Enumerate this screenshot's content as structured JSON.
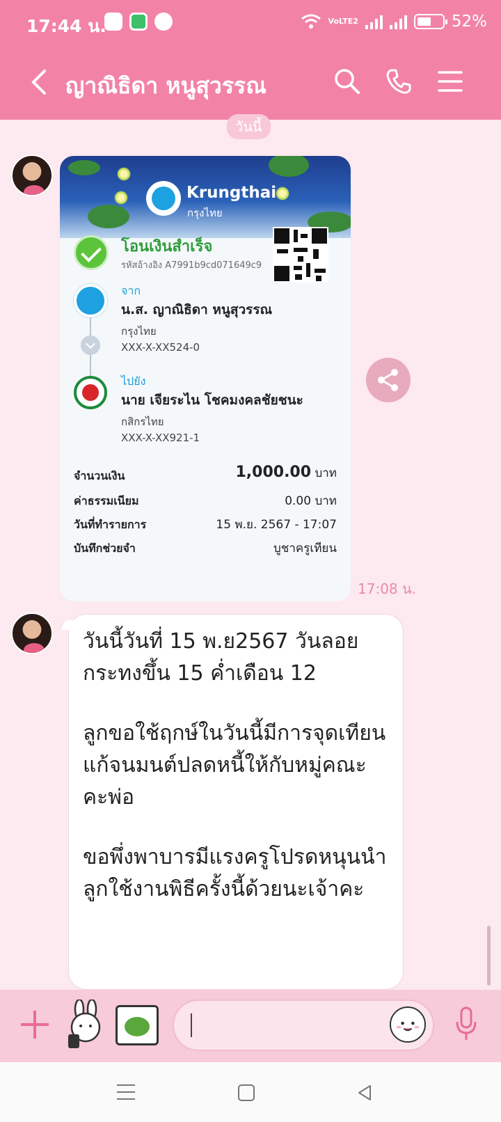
{
  "status_bar": {
    "time": "17:44 น.",
    "notification_icons": [
      "line-icon",
      "message-icon",
      "krungthai-icon"
    ],
    "network_label": "VoLTE2",
    "battery": "52%",
    "battery_level": 0.52
  },
  "header": {
    "title": "ญาณิธิดา หนูสุวรรณ",
    "icons": [
      "back-icon",
      "search-icon",
      "phone-icon",
      "menu-icon"
    ]
  },
  "chat": {
    "date_separator": "วันนี้",
    "slip": {
      "bank_name_en": "Krungthai",
      "bank_name_th": "กรุงไทย",
      "status": "โอนเงินสำเร็จ",
      "reference": "รหัสอ้างอิง A7991b9cd071649c9",
      "from": {
        "label": "จาก",
        "name": "น.ส. ญาณิธิดา หนูสุวรรณ",
        "bank": "กรุงไทย",
        "account": "XXX-X-XX524-0"
      },
      "to": {
        "label": "ไปยัง",
        "name": "นาย เจียระไน โชคมงคลชัยชนะ",
        "bank": "กสิกรไทย",
        "account": "XXX-X-XX921-1"
      },
      "amount_label": "จำนวนเงิน",
      "amount": "1,000.00",
      "amount_unit": "บาท",
      "fee_label": "ค่าธรรมเนียม",
      "fee": "0.00 บาท",
      "date_label": "วันที่ทำรายการ",
      "date": "15 พ.ย. 2567 - 17:07",
      "memo_label": "บันทึกช่วยจำ",
      "memo": "บูชาครูเทียน"
    },
    "slip_time": "17:08 น.",
    "message": {
      "paragraph1": "วันนี้วันที่ 15 พ.ย2567 วันลอยกระทงขึ้น 15 ค่ำเดือน 12",
      "paragraph2": "ลูกขอใช้ฤกษ์ในวันนี้มีการจุดเทียนแก้จนมนต์ปลดหนี้ให้กับหมู่คณะคะพ่อ",
      "paragraph3": "ขอพึ่งพาบารมีแรงครูโปรดหนุนนำลูกใช้งานพิธีครั้งนี้ด้วยนะเจ้าคะ"
    }
  },
  "input_bar": {
    "placeholder": "",
    "icons": [
      "plus-icon",
      "sticker-cony-icon",
      "sticker-image-icon",
      "emoji-icon",
      "mic-icon"
    ]
  },
  "colors": {
    "header": "#f283a7",
    "chat_bg": "#fde9f0",
    "success_green": "#2e9c3a",
    "krungthai_blue": "#1da1e0"
  }
}
